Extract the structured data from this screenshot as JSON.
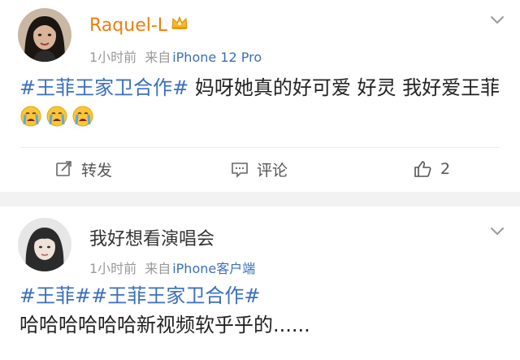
{
  "posts": [
    {
      "username": "Raquel-L",
      "time": "1小时前",
      "source_prefix": "来自",
      "client": "iPhone 12 Pro",
      "topic": "#王菲王家卫合作#",
      "text": " 妈呀她真的好可爱 好灵 我好爱王菲",
      "emoji": [
        "crying-emoji",
        "crying-emoji",
        "crying-emoji"
      ],
      "actions": {
        "repost": "转发",
        "comment": "评论",
        "like_count": "2"
      }
    },
    {
      "username": "我好想看演唱会",
      "time": "1小时前",
      "source_prefix": "来自",
      "client": "iPhone客户端",
      "topic1": "#王菲#",
      "topic2": "#王菲王家卫合作#",
      "text": "哈哈哈哈哈哈新视频软乎乎的......"
    }
  ],
  "colors": {
    "username_vip": "#f27c0d",
    "topic_link": "#3a6fbf",
    "meta_gray": "#999999",
    "separator": "#f2f2f2"
  }
}
